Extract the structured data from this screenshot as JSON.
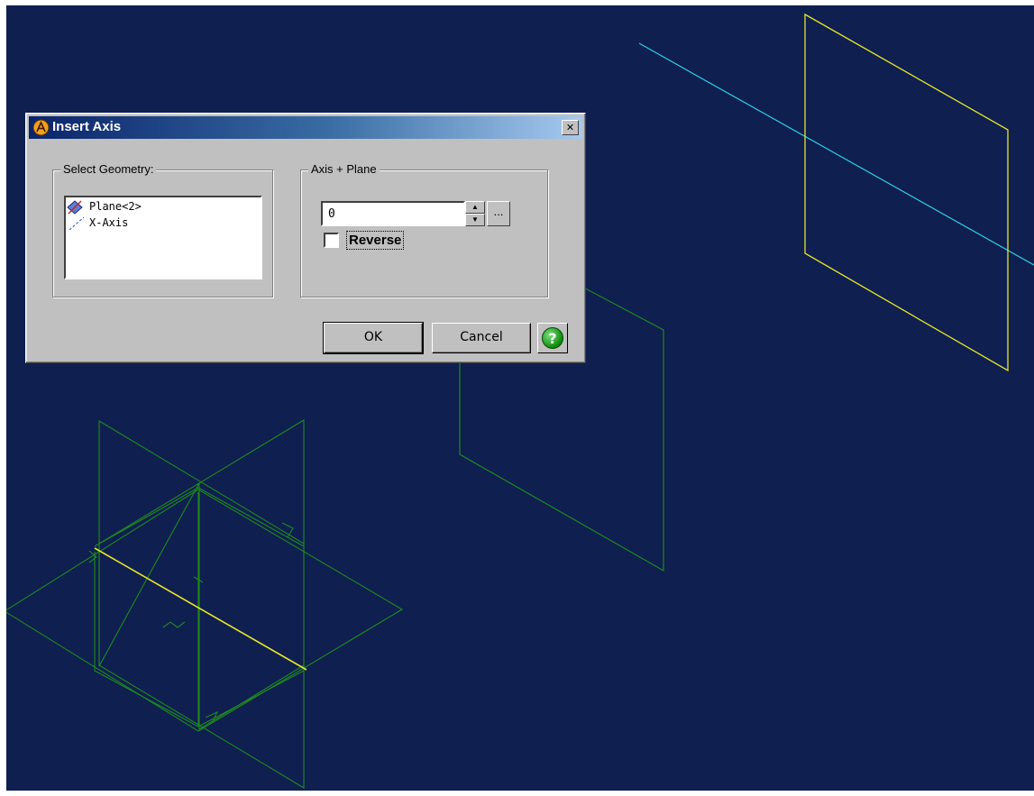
{
  "dialog": {
    "title": "Insert Axis",
    "close_glyph": "✕",
    "select_geometry": {
      "legend": "Select Geometry:",
      "items": [
        {
          "label": "Plane<2>",
          "icon": "plane-icon"
        },
        {
          "label": "X-Axis",
          "icon": "axis-icon"
        }
      ]
    },
    "axis_plane": {
      "legend": "Axis + Plane",
      "value": "0",
      "spin_up": "▲",
      "spin_down": "▼",
      "browse_label": "...",
      "reverse_label": "Reverse",
      "reverse_checked": false
    },
    "buttons": {
      "ok": "OK",
      "cancel": "Cancel",
      "help": "?"
    }
  },
  "viewport": {
    "background": "#0f1f4f",
    "colors": {
      "construction": "#1f8a1f",
      "highlight_yellow": "#e6e62a",
      "axis_cyan": "#2fd0e6"
    }
  }
}
